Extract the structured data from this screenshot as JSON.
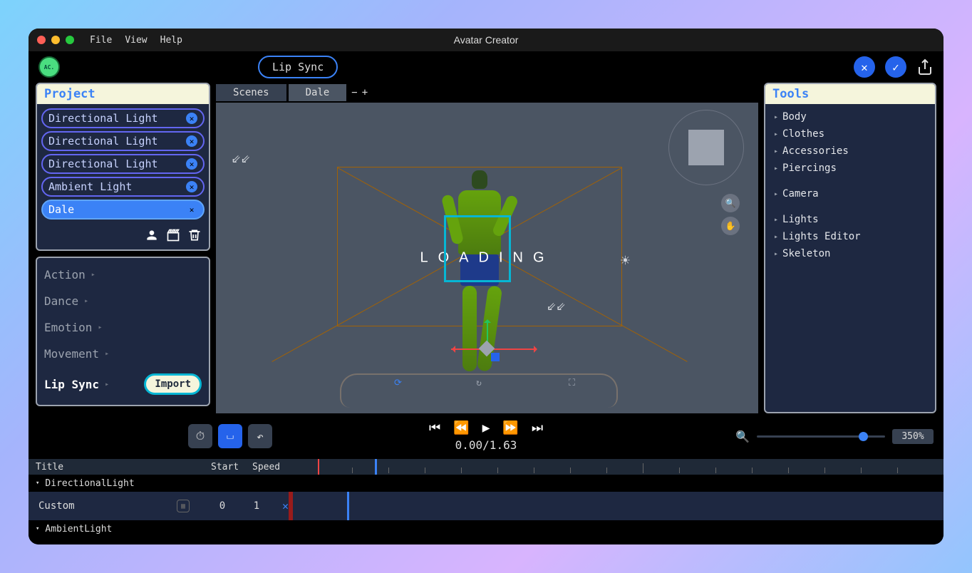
{
  "app": {
    "title": "Avatar Creator"
  },
  "menu": {
    "file": "File",
    "view": "View",
    "help": "Help"
  },
  "avatar_badge": "AC.",
  "mode_pill": "Lip Sync",
  "project": {
    "header": "Project",
    "items": [
      {
        "label": "Directional Light",
        "selected": false
      },
      {
        "label": "Directional Light",
        "selected": false
      },
      {
        "label": "Directional Light",
        "selected": false
      },
      {
        "label": "Ambient Light",
        "selected": false
      },
      {
        "label": "Dale",
        "selected": true
      }
    ]
  },
  "categories": {
    "items": [
      {
        "label": "Action",
        "active": false
      },
      {
        "label": "Dance",
        "active": false
      },
      {
        "label": "Emotion",
        "active": false
      },
      {
        "label": "Movement",
        "active": false
      },
      {
        "label": "Lip Sync",
        "active": true
      }
    ],
    "import": "Import"
  },
  "viewport": {
    "tabs": [
      {
        "label": "Scenes",
        "active": false
      },
      {
        "label": "Dale",
        "active": true
      }
    ],
    "loading": "LOADING"
  },
  "tools": {
    "header": "Tools",
    "groups": [
      [
        "Body",
        "Clothes",
        "Accessories",
        "Piercings"
      ],
      [
        "Camera"
      ],
      [
        "Lights",
        "Lights Editor",
        "Skeleton"
      ]
    ]
  },
  "playback": {
    "time": "0.00/1.63",
    "zoom": "350%"
  },
  "timeline": {
    "cols": {
      "title": "Title",
      "start": "Start",
      "speed": "Speed"
    },
    "tracks": [
      {
        "name": "DirectionalLight"
      }
    ],
    "custom": {
      "label": "Custom",
      "start": "0",
      "speed": "1"
    },
    "tracks2": [
      {
        "name": "AmbientLight"
      }
    ]
  }
}
